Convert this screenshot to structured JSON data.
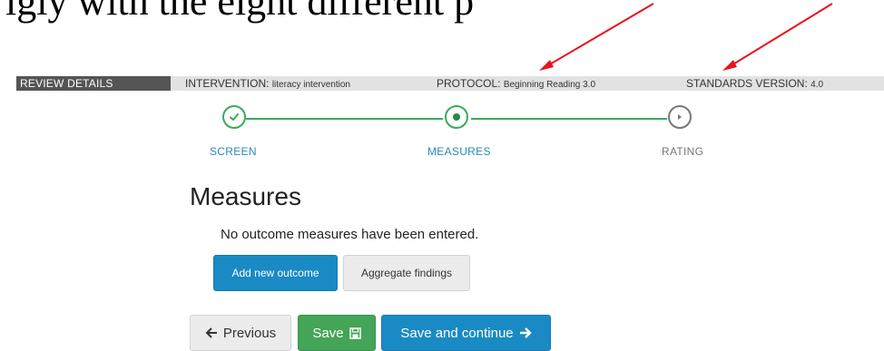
{
  "caption": "igly with the eight different p",
  "review_bar": {
    "label": "REVIEW DETAILS",
    "intervention_key": "INTERVENTION:",
    "intervention_value": "literacy intervention",
    "protocol_key": "PROTOCOL:",
    "protocol_value": "Beginning Reading 3.0",
    "standards_key": "STANDARDS VERSION:",
    "standards_value": "4.0"
  },
  "stepper": {
    "steps": [
      {
        "label": "SCREEN",
        "state": "complete"
      },
      {
        "label": "MEASURES",
        "state": "current"
      },
      {
        "label": "RATING",
        "state": "pending"
      }
    ]
  },
  "page": {
    "title": "Measures",
    "empty_message": "No outcome measures have been entered."
  },
  "buttons": {
    "add_outcome": "Add new outcome",
    "aggregate": "Aggregate findings",
    "previous": "Previous",
    "save": "Save",
    "save_continue": "Save and continue"
  },
  "colors": {
    "accent_green": "#3aaa5a",
    "primary_blue": "#1a8ac4",
    "arrow_red": "#e8141c"
  },
  "icons": [
    "check-icon",
    "dot-icon",
    "play-icon",
    "arrow-left-icon",
    "save-icon",
    "arrow-right-icon"
  ]
}
